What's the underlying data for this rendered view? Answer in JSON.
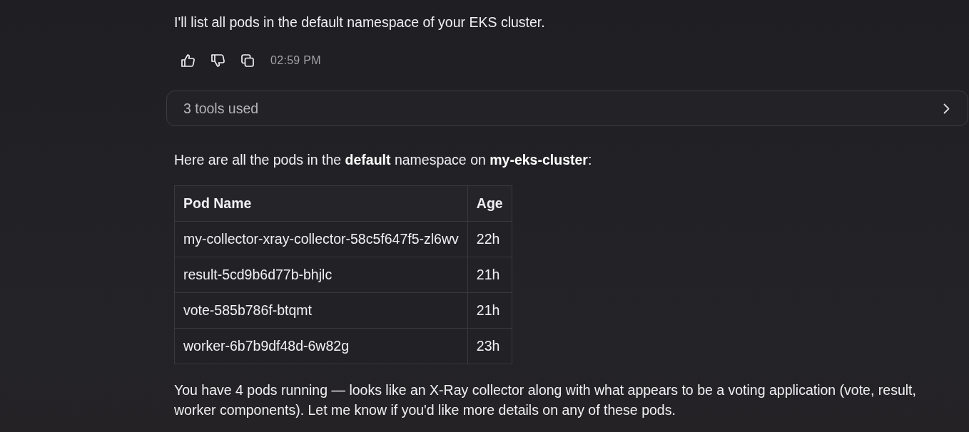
{
  "intro": {
    "text": "I'll list all pods in the default namespace of your EKS cluster."
  },
  "actions": {
    "time": "02:59 PM"
  },
  "tools_panel": {
    "label": "3 tools used",
    "expanded": false
  },
  "summary": {
    "text": "Here are all the pods in the **default** namespace on **my-eks-cluster**:"
  },
  "table": {
    "columns": [
      "Pod Name",
      "Age"
    ],
    "rows": [
      [
        "my-collector-xray-collector-58c5f647f5-zl6wv",
        "22h"
      ],
      [
        "result-5cd9b6d77b-bhjlc",
        "21h"
      ],
      [
        "vote-585b786f-btqmt",
        "21h"
      ],
      [
        "worker-6b7b9df48d-6w82g",
        "23h"
      ]
    ]
  },
  "closing": {
    "text": "You have 4 pods running — looks like an X-Ray collector along with what appears to be a voting application (vote, result, worker components). Let me know if you'd like more details on any of these pods."
  }
}
